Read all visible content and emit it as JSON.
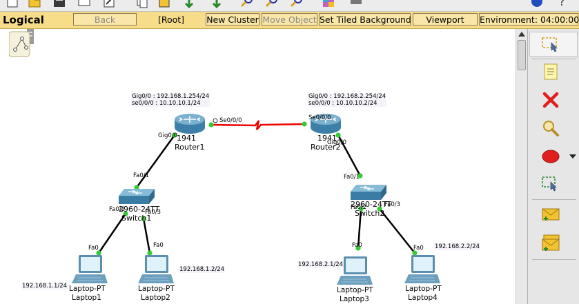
{
  "toolbar": {
    "logical_label": "Logical",
    "back_label": "Back",
    "root_label": "[Root]",
    "new_cluster_label": "New Cluster",
    "move_object_label": "Move Object",
    "set_tiled_bg_label": "Set Tiled Background",
    "viewport_label": "Viewport",
    "environment_label": "Environment: 04:00:00"
  },
  "colors": {
    "toolbar_bg": "#f7dc8a",
    "serial_link": "#ee0000",
    "ethernet_link": "#000000",
    "port_up": "#33cc33",
    "delete_red": "#e02020"
  },
  "right_tools": [
    "select-icon",
    "note-icon",
    "delete-icon",
    "inspect-icon",
    "draw-ellipse-icon",
    "resize-icon",
    "add-simple-pdu-icon",
    "add-complex-pdu-icon"
  ],
  "devices": {
    "router1": {
      "model": "1941",
      "name": "Router1",
      "tooltip_line1": "Gig0/0 : 192.168.1.254/24",
      "tooltip_line2": "se0/0/0 : 10.10.10.1/24",
      "port_gig": "Gig0/0",
      "port_serial": "Se0/0/0"
    },
    "router2": {
      "model": "1941",
      "name": "Router2",
      "tooltip_line1": "Gig0/0 : 192.168.2.254/24",
      "tooltip_line2": "se0/0/0 : 10.10.10.2/24",
      "port_gig": "Gig0/0",
      "port_serial": "Se0/0/0"
    },
    "switch1": {
      "model": "2960-24TT",
      "name": "Switch1",
      "port_up": "Fa0/1",
      "port_left": "Fa0/2",
      "port_right": "Fa0/3"
    },
    "switch2": {
      "model": "2960-24TT",
      "name": "Switch2",
      "port_up": "Fa0/1",
      "port_left": "Fa0/2",
      "port_right": "Fa0/3"
    },
    "laptop1": {
      "model": "Laptop-PT",
      "name": "Laptop1",
      "ip": "192.168.1.1/24",
      "port": "Fa0"
    },
    "laptop2": {
      "model": "Laptop-PT",
      "name": "Laptop2",
      "ip": "192.168.1.2/24",
      "port": "Fa0"
    },
    "laptop3": {
      "model": "Laptop-PT",
      "name": "Laptop3",
      "ip": "192.168.2.1/24",
      "port": "Fa0"
    },
    "laptop4": {
      "model": "Laptop-PT",
      "name": "Laptop4",
      "ip": "192.168.2.2/24",
      "port": "Fa0"
    }
  }
}
